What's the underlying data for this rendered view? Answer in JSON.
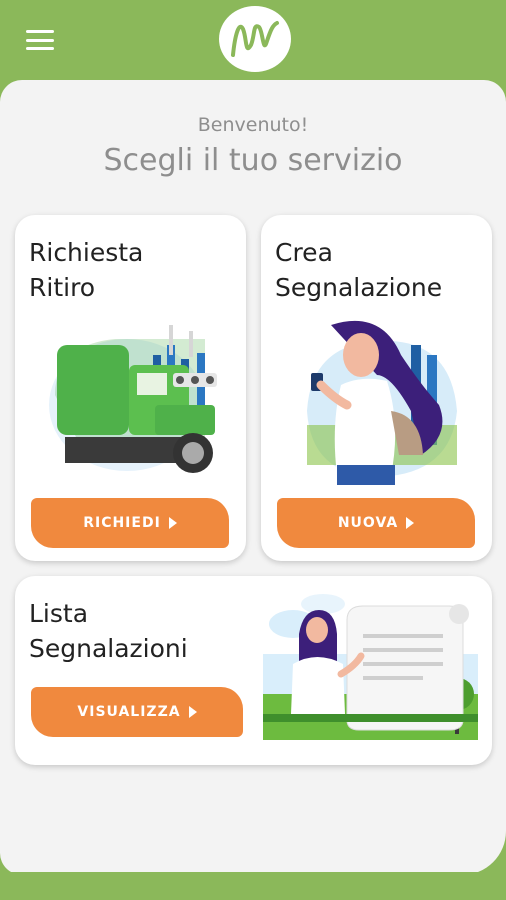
{
  "header": {
    "menu_icon": "hamburger-menu-icon",
    "logo_icon": "m-waveform-logo"
  },
  "greeting": "Benvenuto!",
  "subtitle": "Scegli il tuo servizio",
  "cards": [
    {
      "title": "Richiesta\nRitiro",
      "button": "RICHIEDI",
      "illustration": "garbage-truck-illustration"
    },
    {
      "title": "Crea\nSegnalazione",
      "button": "NUOVA",
      "illustration": "woman-with-phone-illustration"
    },
    {
      "title": "Lista\nSegnalazioni",
      "button": "VISUALIZZA",
      "illustration": "woman-reading-list-illustration"
    }
  ],
  "colors": {
    "brand_green": "#8bb85a",
    "accent_orange": "#f0893e",
    "background": "#f3f3f3",
    "text_gray": "#8e8e8e"
  }
}
